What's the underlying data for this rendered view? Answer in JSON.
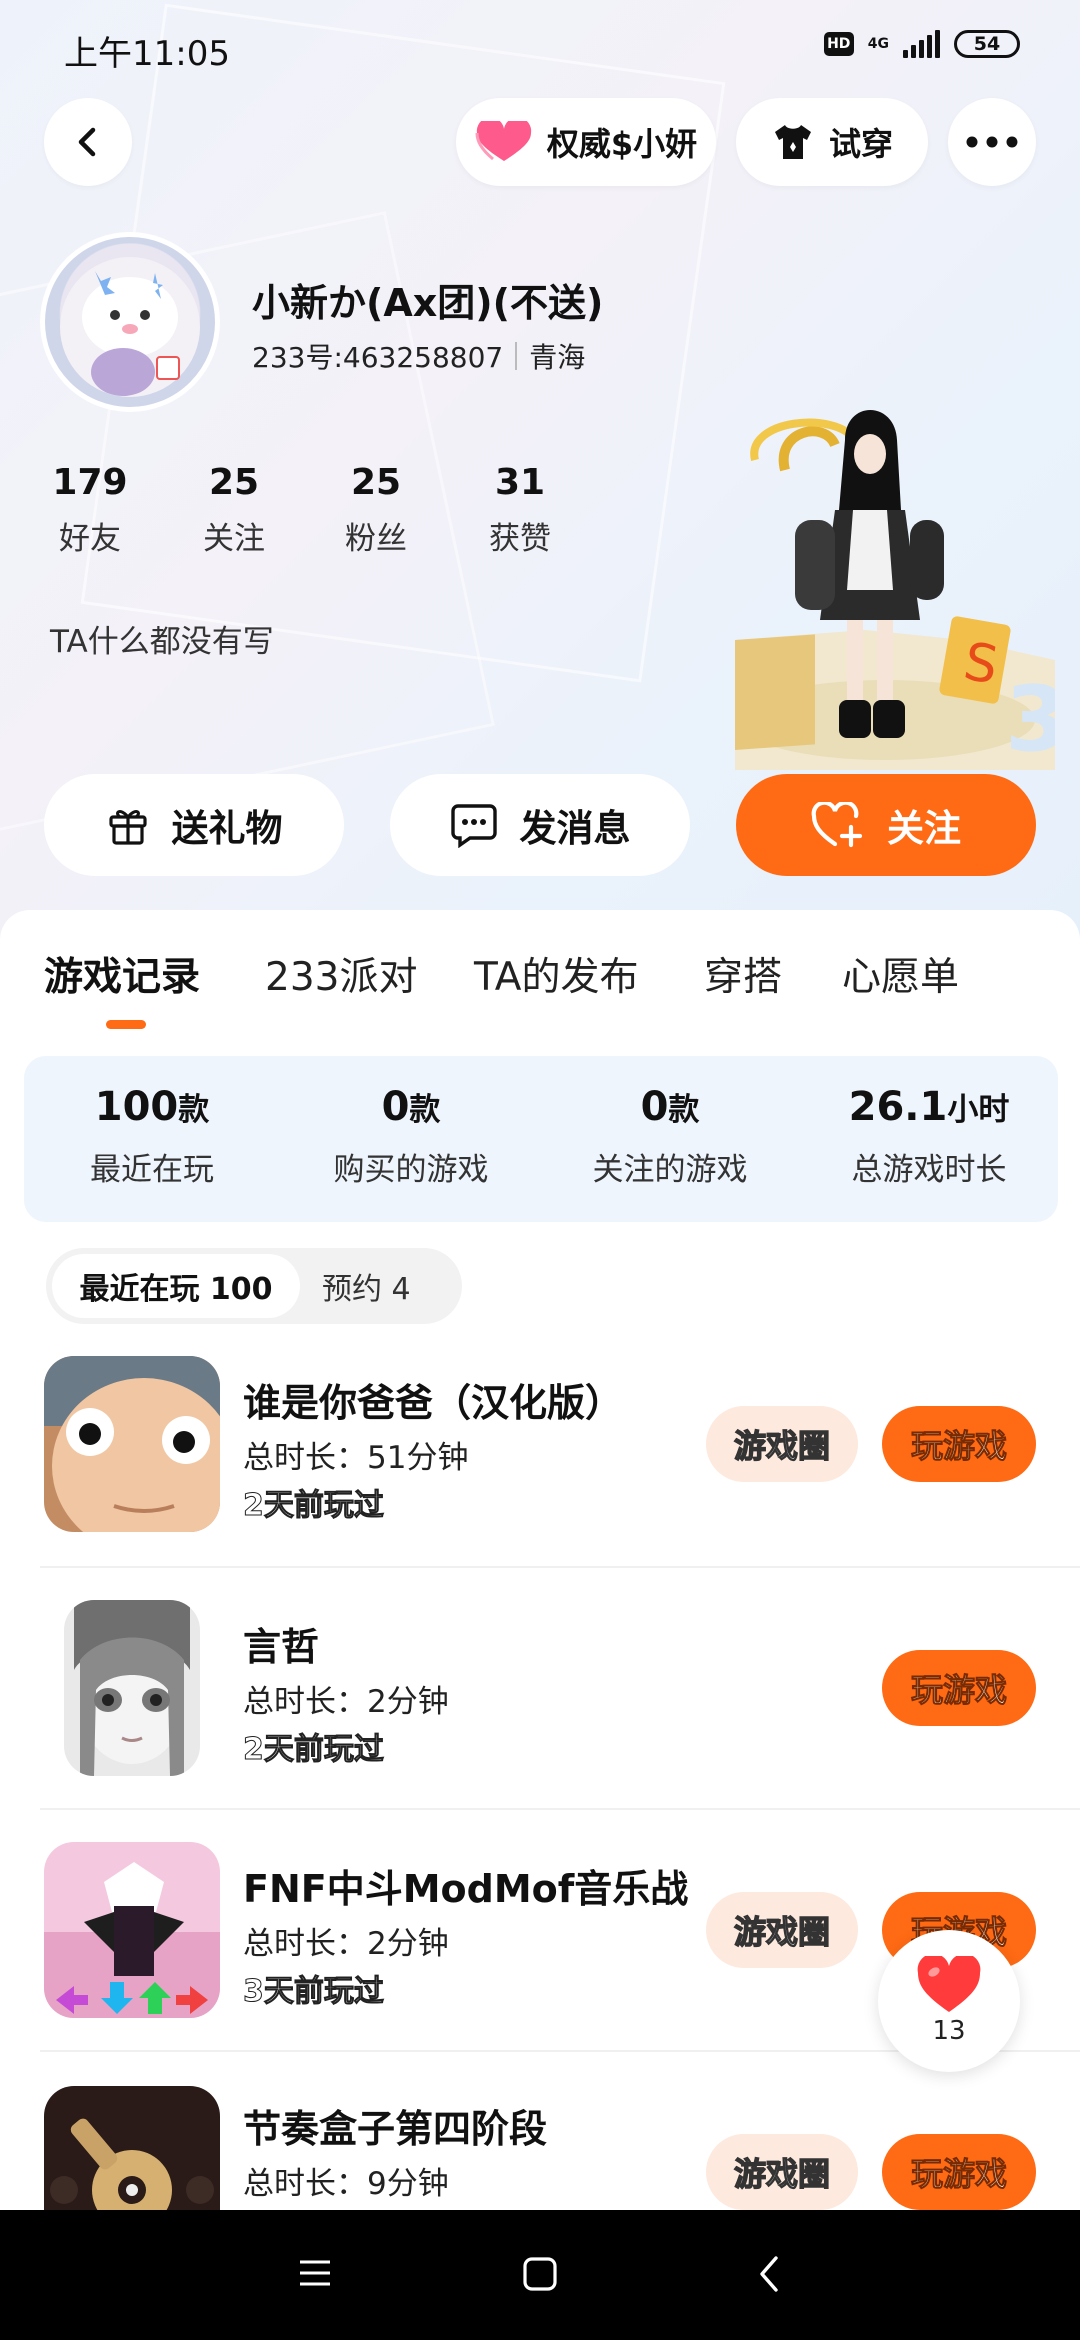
{
  "status": {
    "time": "上午11:05",
    "hd": "HD",
    "net": "4G",
    "battery": "54"
  },
  "header": {
    "tag_label": "权威$小妍",
    "try_on_label": "试穿"
  },
  "profile": {
    "name": "小新か(Ax团)(不送)",
    "uid": "233号:463258807",
    "region": "青海",
    "bio": "TA什么都没有写",
    "stats": [
      {
        "value": "179",
        "label": "好友"
      },
      {
        "value": "25",
        "label": "关注"
      },
      {
        "value": "25",
        "label": "粉丝"
      },
      {
        "value": "31",
        "label": "获赞"
      }
    ]
  },
  "actions": {
    "gift": "送礼物",
    "message": "发消息",
    "follow": "关注"
  },
  "tabs": [
    "游戏记录",
    "233派对",
    "TA的发布",
    "穿搭",
    "心愿单"
  ],
  "summary": [
    {
      "value": "100",
      "unit": "款",
      "label": "最近在玩"
    },
    {
      "value": "0",
      "unit": "款",
      "label": "购买的游戏"
    },
    {
      "value": "0",
      "unit": "款",
      "label": "关注的游戏"
    },
    {
      "value": "26.1",
      "unit": "小时",
      "label": "总游戏时长"
    }
  ],
  "segment": {
    "recent": "最近在玩 100",
    "reserve": "预约 4"
  },
  "games": [
    {
      "title": "谁是你爸爸（汉化版）",
      "duration": "总时长：51分钟",
      "ago": "2天前玩过",
      "circle": "游戏圈",
      "play": "玩游戏"
    },
    {
      "title": "言哲",
      "duration": "总时长：2分钟",
      "ago": "2天前玩过",
      "play": "玩游戏"
    },
    {
      "title": "FNF中斗ModMof音乐战",
      "duration": "总时长：2分钟",
      "ago": "3天前玩过",
      "circle": "游戏圈",
      "play": "玩游戏"
    },
    {
      "title": "节奏盒子第四阶段",
      "duration": "总时长：9分钟",
      "circle": "游戏圈",
      "play": "玩游戏"
    }
  ],
  "like_count": "13",
  "colors": {
    "accent": "#ff6a14",
    "summary_bg": "#eef5fd",
    "circle_btn_bg": "#fde9de"
  }
}
